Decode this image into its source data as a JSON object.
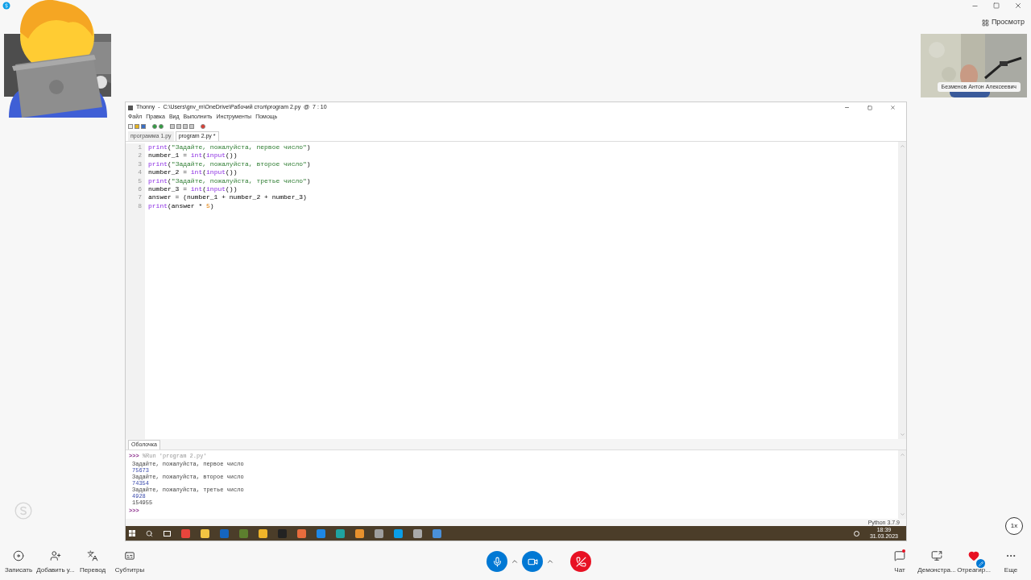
{
  "view_button": "Просмотр",
  "remote_participant": {
    "name": "Безменов Антон Алексеевич"
  },
  "shared_screen": {
    "window_title": "Thonny  -  C:\\Users\\gnv_m\\OneDrive\\Рабочий стол\\program 2.py  @  7 : 10",
    "menu": [
      "Файл",
      "Правка",
      "Вид",
      "Выполнить",
      "Инструменты",
      "Помощь"
    ],
    "tabs": [
      {
        "label": "программа 1.py",
        "selected": false
      },
      {
        "label": "program 2.py *",
        "selected": true
      }
    ],
    "code": [
      {
        "number": "1",
        "tokens": [
          {
            "kind": "builtin",
            "text": "print"
          },
          {
            "kind": "plain",
            "text": "("
          },
          {
            "kind": "string",
            "text": "\"Задайте, пожалуйста, первое число\""
          },
          {
            "kind": "plain",
            "text": ")"
          }
        ]
      },
      {
        "number": "2",
        "tokens": [
          {
            "kind": "plain",
            "text": "number_1 = "
          },
          {
            "kind": "builtin",
            "text": "int"
          },
          {
            "kind": "plain",
            "text": "("
          },
          {
            "kind": "builtin",
            "text": "input"
          },
          {
            "kind": "plain",
            "text": "())"
          }
        ]
      },
      {
        "number": "3",
        "tokens": [
          {
            "kind": "builtin",
            "text": "print"
          },
          {
            "kind": "plain",
            "text": "("
          },
          {
            "kind": "string",
            "text": "\"Задайте, пожалуйста, второе число\""
          },
          {
            "kind": "plain",
            "text": ")"
          }
        ]
      },
      {
        "number": "4",
        "tokens": [
          {
            "kind": "plain",
            "text": "number_2 = "
          },
          {
            "kind": "builtin",
            "text": "int"
          },
          {
            "kind": "plain",
            "text": "("
          },
          {
            "kind": "builtin",
            "text": "input"
          },
          {
            "kind": "plain",
            "text": "())"
          }
        ]
      },
      {
        "number": "5",
        "tokens": [
          {
            "kind": "builtin",
            "text": "print"
          },
          {
            "kind": "plain",
            "text": "("
          },
          {
            "kind": "string",
            "text": "\"Задайте, пожалуйста, третье число\""
          },
          {
            "kind": "plain",
            "text": ")"
          }
        ]
      },
      {
        "number": "6",
        "tokens": [
          {
            "kind": "plain",
            "text": "number_3 = "
          },
          {
            "kind": "builtin",
            "text": "int"
          },
          {
            "kind": "plain",
            "text": "("
          },
          {
            "kind": "builtin",
            "text": "input"
          },
          {
            "kind": "plain",
            "text": "())"
          }
        ]
      },
      {
        "number": "7",
        "tokens": [
          {
            "kind": "plain",
            "text": "answer = (number_1 + number_2 + number_3)"
          }
        ]
      },
      {
        "number": "8",
        "tokens": [
          {
            "kind": "builtin",
            "text": "print"
          },
          {
            "kind": "plain",
            "text": "(answer * "
          },
          {
            "kind": "number",
            "text": "5"
          },
          {
            "kind": "plain",
            "text": ")"
          }
        ]
      }
    ],
    "shell": {
      "tab": "Оболочка",
      "lines": [
        {
          "kind": "prompt",
          "prompt": ">>>",
          "text": "%Run 'program 2.py'"
        },
        {
          "kind": "output",
          "text": "Задайте, пожалуйста, первое число"
        },
        {
          "kind": "input",
          "text": "75673"
        },
        {
          "kind": "output",
          "text": "Задайте, пожалуйста, второе число"
        },
        {
          "kind": "input",
          "text": "74354"
        },
        {
          "kind": "output",
          "text": "Задайте, пожалуйста, третье число"
        },
        {
          "kind": "input",
          "text": "4928"
        },
        {
          "kind": "output",
          "text": "154955"
        },
        {
          "kind": "prompt",
          "prompt": ">>>"
        }
      ]
    },
    "status": "Python 3.7.9",
    "clock": {
      "time": "18:39",
      "date": "31.03.2023"
    }
  },
  "speed": "1x",
  "call_controls": {
    "mic_on": true,
    "camera_on": true
  },
  "toolbar_left": [
    {
      "kind": "record",
      "label": "Записать"
    },
    {
      "kind": "add_person",
      "label": "Добавить у..."
    },
    {
      "kind": "translate",
      "label": "Перевод"
    },
    {
      "kind": "captions",
      "label": "Субтитры"
    }
  ],
  "toolbar_right": [
    {
      "kind": "chat",
      "label": "Чат"
    },
    {
      "kind": "share",
      "label": "Демонстра..."
    },
    {
      "kind": "react",
      "label": "Отреагир..."
    },
    {
      "kind": "more",
      "label": "Еще"
    }
  ]
}
